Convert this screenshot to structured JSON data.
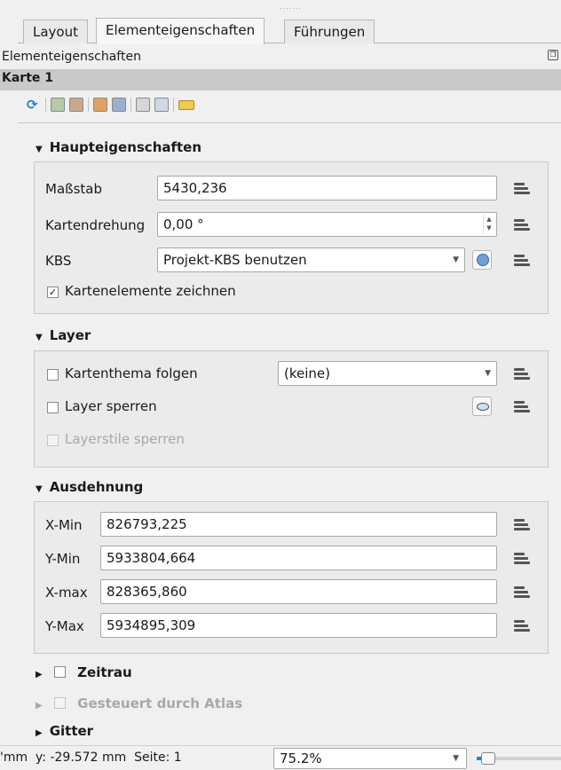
{
  "tabs": [
    {
      "label": "Layout"
    },
    {
      "label": "Elementeigenschaften"
    },
    {
      "label": "Führungen"
    }
  ],
  "panel_title": "Elementeigenschaften",
  "item_title": "Karte 1",
  "toolbar_icons": [
    "refresh-icon",
    "set-extent-icon",
    "view-extent-icon",
    "set-scale-icon",
    "view-scale-icon",
    "bookmark-icon",
    "labels-icon",
    "label-settings-icon"
  ],
  "main_section": {
    "title": "Haupteigenschaften",
    "scale_label": "Maßstab",
    "scale_value": "5430,236",
    "rotation_label": "Kartendrehung",
    "rotation_value": "0,00 °",
    "crs_label": "KBS",
    "crs_value": "Projekt-KBS benutzen",
    "draw_items_label": "Kartenelemente zeichnen",
    "draw_items_checked": true,
    "checkmark": "✓"
  },
  "layer_section": {
    "title": "Layer",
    "follow_theme_label": "Kartenthema folgen",
    "theme_value": "(keine)",
    "lock_layers_label": "Layer sperren",
    "lock_styles_label": "Layerstile sperren"
  },
  "extent_section": {
    "title": "Ausdehnung",
    "fields": [
      {
        "label": "X-Min",
        "value": "826793,225"
      },
      {
        "label": "Y-Min",
        "value": "5933804,664"
      },
      {
        "label": "X-max",
        "value": "828365,860"
      },
      {
        "label": "Y-Max",
        "value": "5934895,309"
      }
    ]
  },
  "collapsed_sections": [
    {
      "title": "Zeitrau",
      "has_checkbox": true,
      "enabled": true
    },
    {
      "title": "Gesteuert durch Atlas",
      "has_checkbox": true,
      "enabled": false
    },
    {
      "title": "Gitter",
      "has_checkbox": false,
      "enabled": true
    }
  ],
  "statusbar": {
    "coords": "'mm  y: -29.572 mm  Seite: 1",
    "zoom": "75.2%",
    "zoom_slider_fraction": 0.05
  },
  "colors": {
    "selected_header": "#c9c9c9",
    "accent_blue": "#2a7fd4"
  }
}
